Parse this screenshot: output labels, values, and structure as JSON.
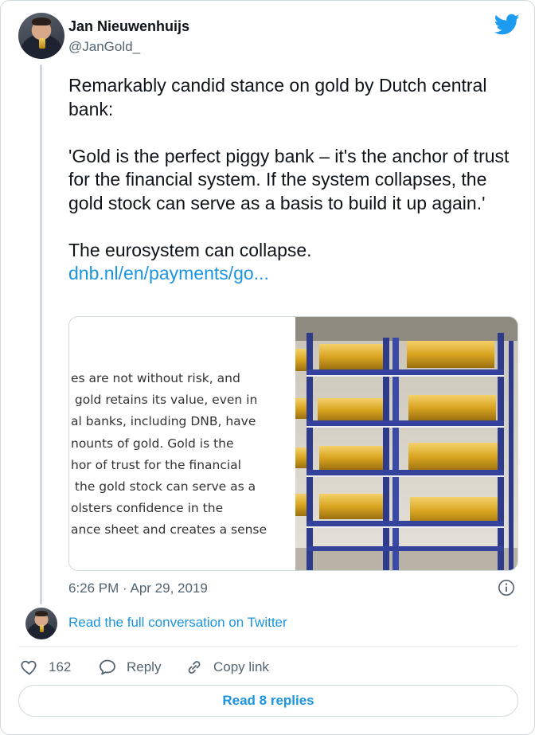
{
  "author": {
    "name": "Jan Nieuwenhuijs",
    "handle": "@JanGold_"
  },
  "icons": {
    "brand": "twitter-bird-icon",
    "info": "info-icon",
    "like": "heart-icon",
    "reply": "reply-bubble-icon",
    "copy_link": "link-icon"
  },
  "tweet": {
    "paragraph_1": "Remarkably candid stance on gold by Dutch central bank:",
    "paragraph_2": "'Gold is the perfect piggy bank – it's the anchor of trust for the financial system. If the system collapses, the gold stock can serve as a basis to build it up again.'",
    "paragraph_3": "The eurosystem can collapse.",
    "link_text": "dnb.nl/en/payments/go..."
  },
  "link_card": {
    "preview_lines": [
      "es are not without risk, and",
      " gold retains its value, even in",
      "al banks, including DNB, have",
      "nounts of gold. Gold is the",
      "hor of trust for the financial",
      " the gold stock can serve as a",
      "olsters confidence in the",
      "ance sheet and creates a sense"
    ]
  },
  "timestamp": "6:26 PM · Apr 29, 2019",
  "read_conversation": "Read the full conversation on Twitter",
  "actions": {
    "like_count": "162",
    "reply_label": "Reply",
    "copy_link_label": "Copy link"
  },
  "read_replies": "Read 8 replies",
  "colors": {
    "link_blue": "#1b95e0",
    "twitter_blue": "#1d9bf0",
    "text_primary": "#0f1419",
    "text_secondary": "#536471",
    "border": "#cfd9de",
    "shelf_blue": "#2e3a8c",
    "gold": "#d9a520"
  }
}
